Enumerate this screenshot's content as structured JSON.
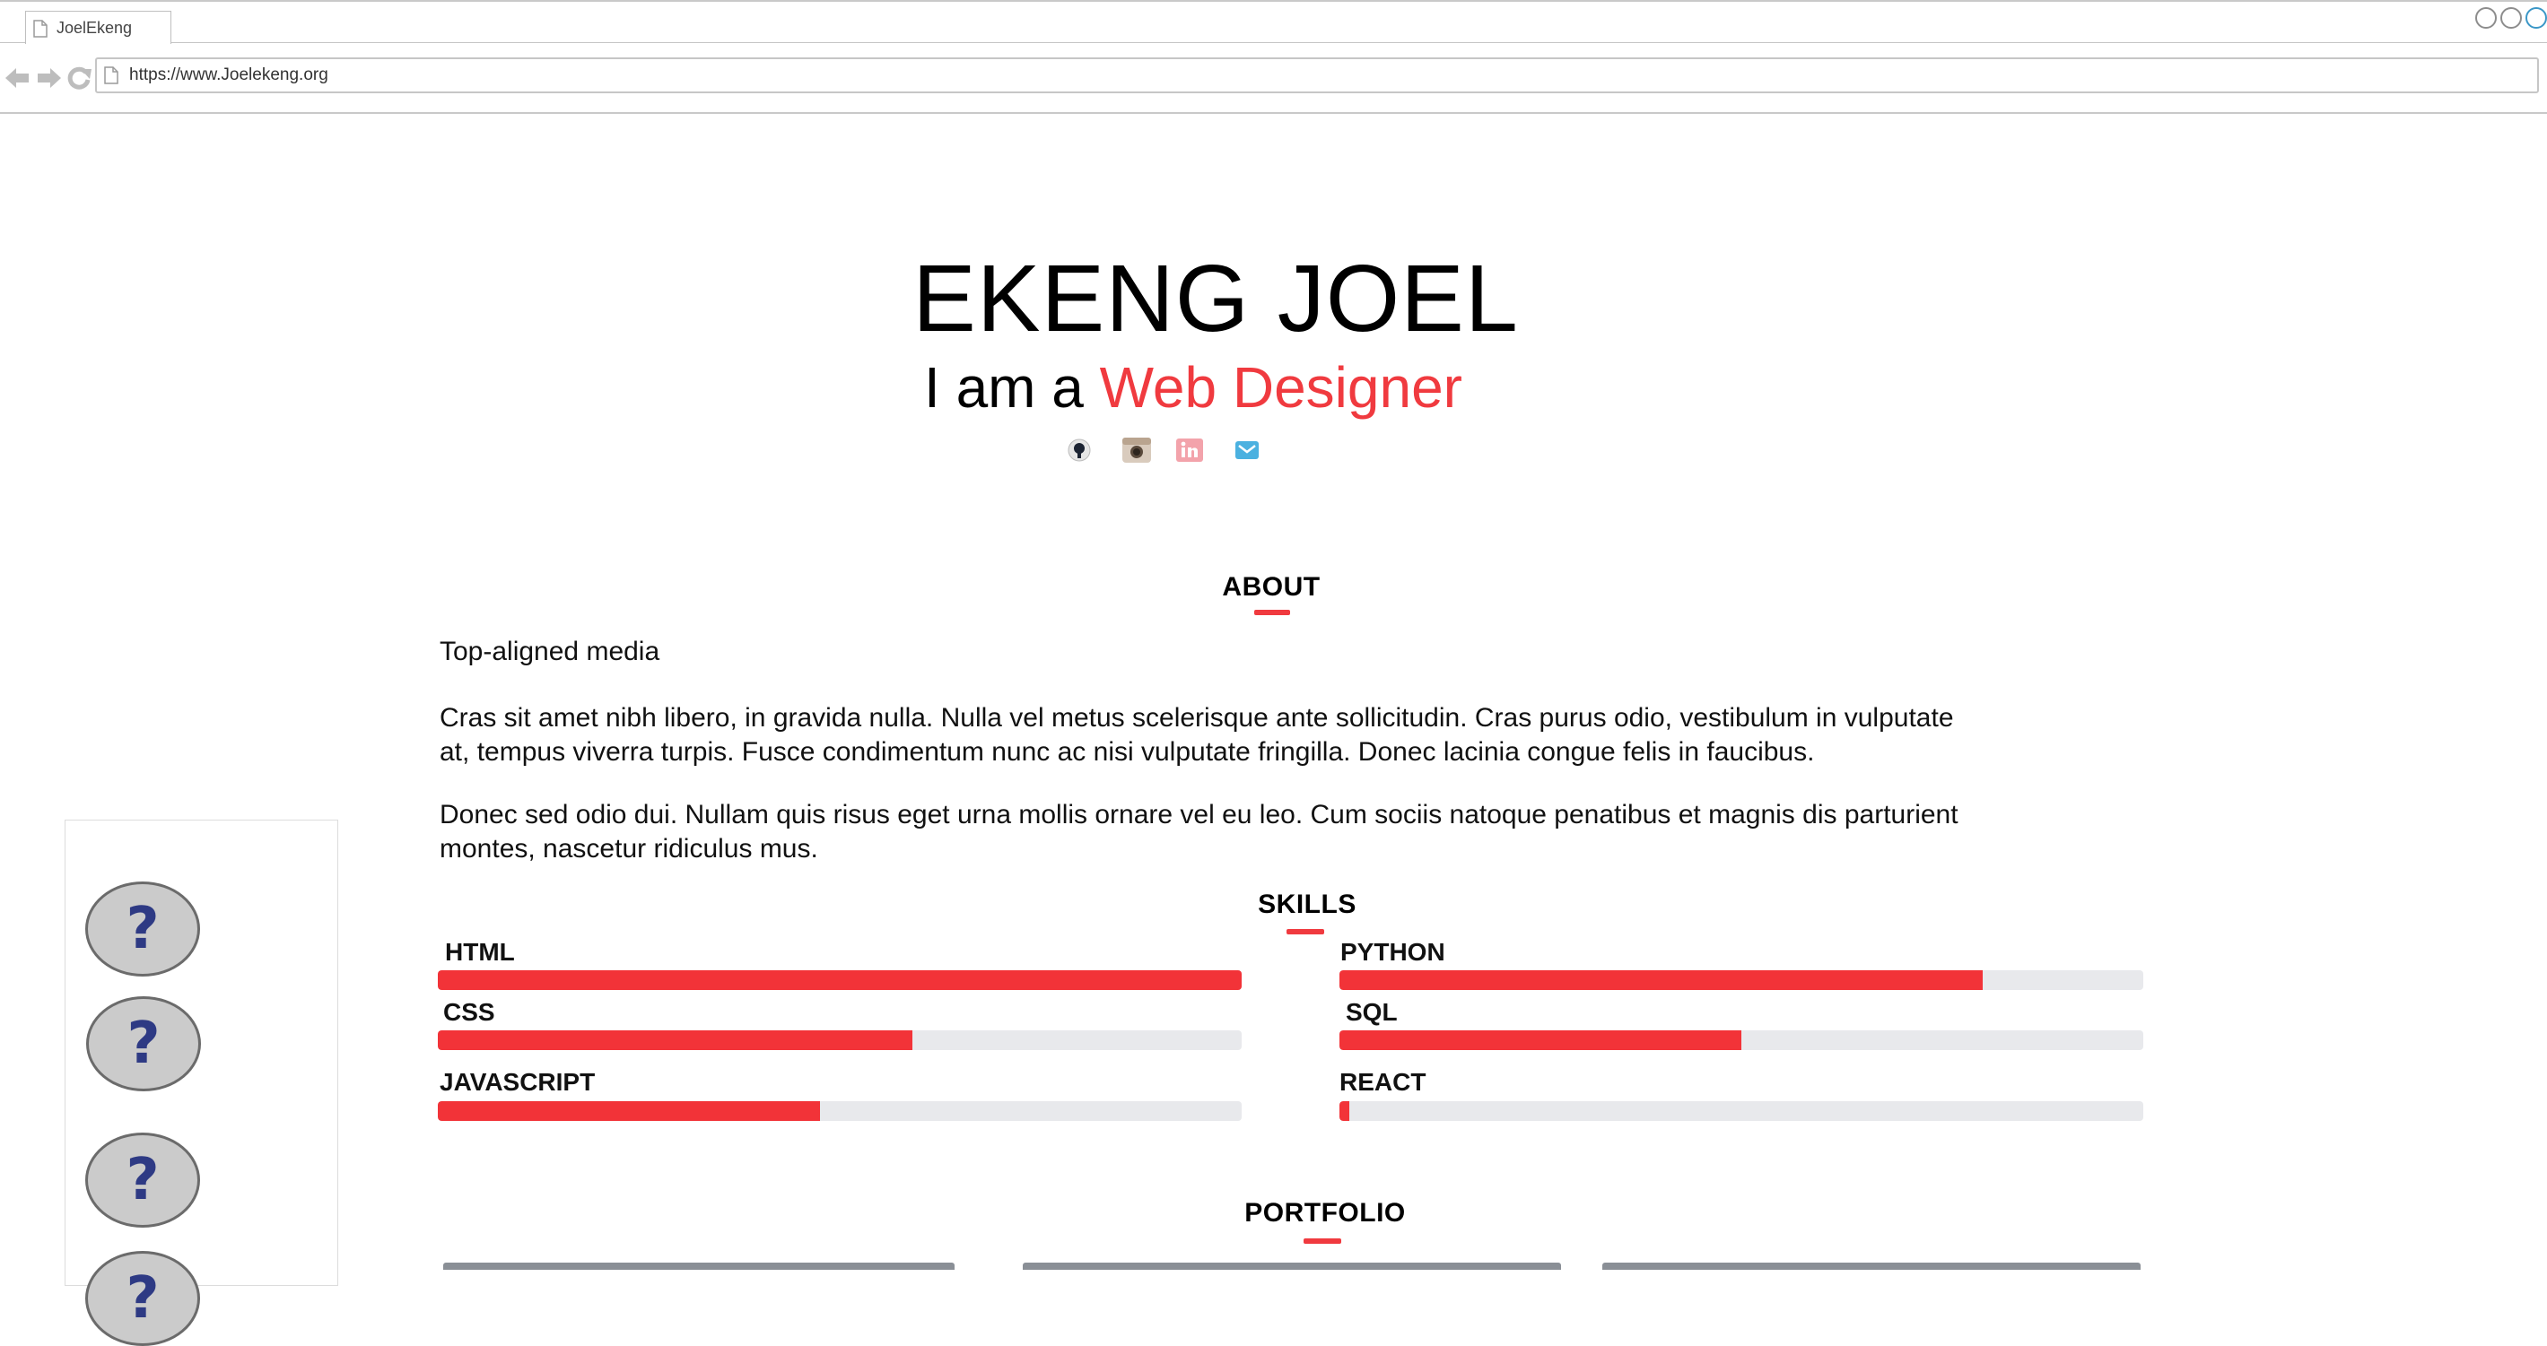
{
  "browser": {
    "tab_title": "JoelEkeng",
    "url": "https://www.Joelekeng.org"
  },
  "hero": {
    "name": "EKENG JOEL",
    "subtitle_prefix": "I am a",
    "subtitle_accent": "Web Designer",
    "accent_color": "#f03a3f",
    "social_icons": [
      "github-icon",
      "instagram-icon",
      "linkedin-icon",
      "twitter-icon"
    ]
  },
  "about": {
    "title": "ABOUT",
    "media_heading": "Top-aligned media",
    "paragraph_1": "Cras sit amet nibh libero, in gravida nulla. Nulla vel metus scelerisque ante sollicitudin. Cras purus odio, vestibulum in vulputate at, tempus viverra turpis. Fusce condimentum nunc ac nisi vulputate fringilla. Donec lacinia congue felis in faucibus.",
    "paragraph_2": "Donec sed odio dui. Nullam quis risus eget urna mollis ornare vel eu leo. Cum sociis natoque penatibus et magnis dis parturient montes, nascetur ridiculus mus."
  },
  "sidebar": {
    "buttons": [
      "?",
      "?",
      "?",
      "?"
    ]
  },
  "skills": {
    "title": "SKILLS",
    "items": [
      {
        "label": "HTML",
        "level": 1.0
      },
      {
        "label": "CSS",
        "level": 0.59
      },
      {
        "label": "JAVASCRIPT",
        "level": 0.475
      },
      {
        "label": "PYTHON",
        "level": 0.8
      },
      {
        "label": "SQL",
        "level": 0.5
      },
      {
        "label": "REACT",
        "level": 0.012
      }
    ],
    "bar_color": "#f23338",
    "track_color": "#e8e9ec"
  },
  "portfolio": {
    "title": "PORTFOLIO"
  }
}
